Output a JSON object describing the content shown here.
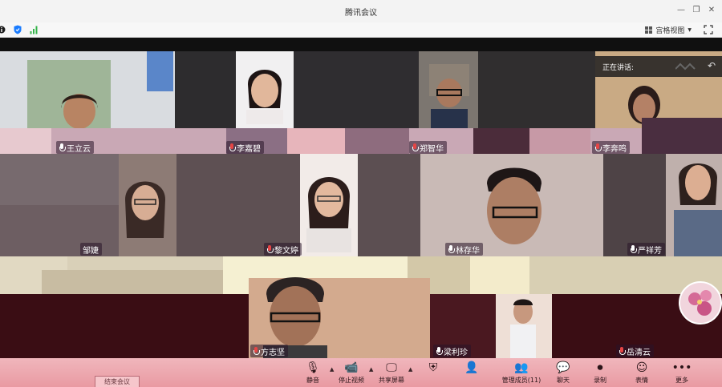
{
  "window": {
    "title": "腾讯会议"
  },
  "toolbar": {
    "view_label": "宫格视图"
  },
  "speaking": {
    "label": "正在讲话:"
  },
  "participants": [
    {
      "name": "王立云"
    },
    {
      "name": "李嘉碧"
    },
    {
      "name": "郑智华"
    },
    {
      "name": "李奔鸣"
    },
    {
      "name": "邹婕"
    },
    {
      "name": "黎文婷"
    },
    {
      "name": "林存华"
    },
    {
      "name": "严祥芳"
    },
    {
      "name": "方志坚"
    },
    {
      "name": "梁利珍"
    },
    {
      "name": "岳清云"
    }
  ],
  "controls": [
    {
      "label": "静音",
      "icon": "mic-icon"
    },
    {
      "label": "停止视频",
      "icon": "camera-icon"
    },
    {
      "label": "共享屏幕",
      "icon": "share-screen-icon"
    },
    {
      "label": "",
      "icon": "security-icon"
    },
    {
      "label": "",
      "icon": "invite-icon"
    },
    {
      "label": "管理成员(11)",
      "icon": "members-icon"
    },
    {
      "label": "聊天",
      "icon": "chat-icon"
    },
    {
      "label": "录制",
      "icon": "record-icon"
    },
    {
      "label": "表情",
      "icon": "emoji-icon"
    },
    {
      "label": "更多",
      "icon": "more-icon"
    }
  ],
  "left_chip": {
    "label": "结束会议"
  },
  "colors": {
    "control_bar": "#ec9fa8",
    "title_bar": "#f3f3f3",
    "stage": "#101010",
    "accent": "#1a7cff"
  }
}
